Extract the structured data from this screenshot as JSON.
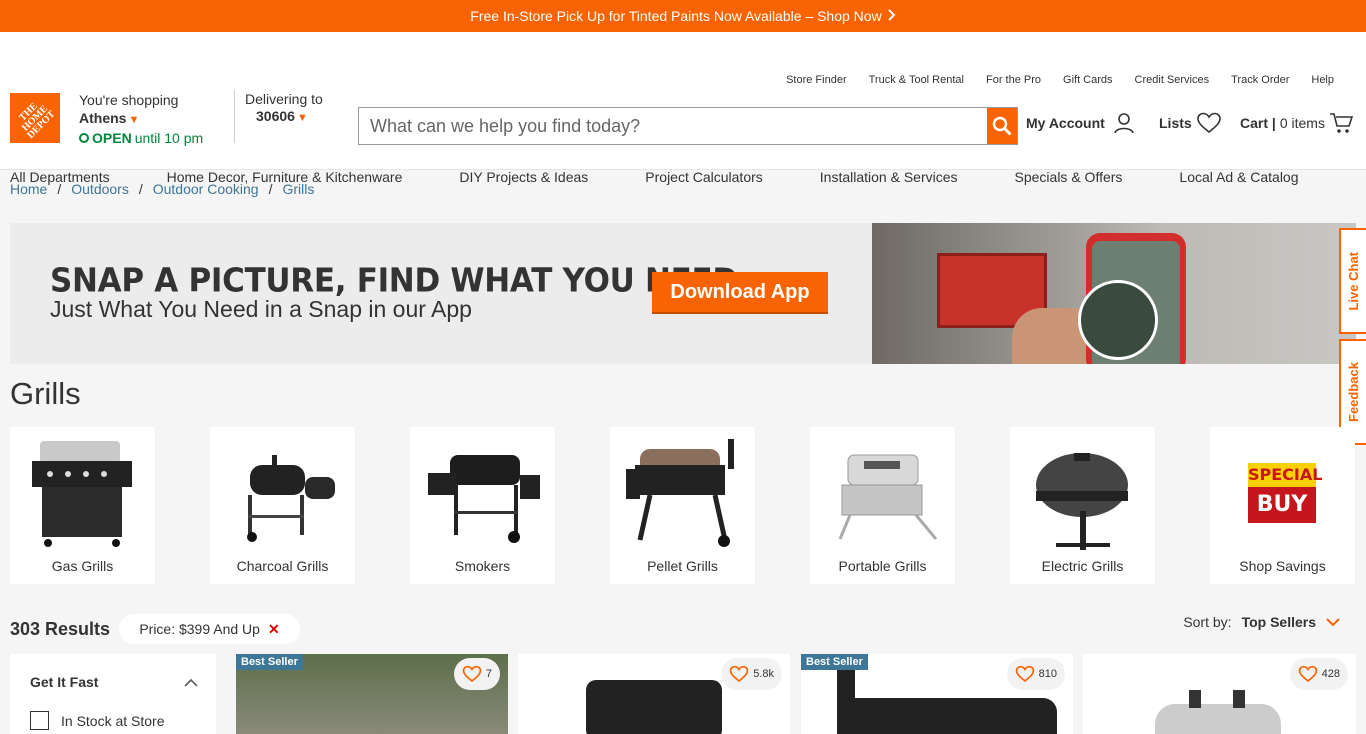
{
  "promo": {
    "text": "Free In-Store Pick Up for Tinted Paints Now Available – Shop Now"
  },
  "logo": {
    "text": "THE HOME DEPOT"
  },
  "store": {
    "label": "You're shopping",
    "city": "Athens",
    "status": "OPEN",
    "hours": "until 10 pm"
  },
  "delivery": {
    "label": "Delivering to",
    "zip": "30606"
  },
  "top_links": [
    "Store Finder",
    "Truck & Tool Rental",
    "For the Pro",
    "Gift Cards",
    "Credit Services",
    "Track Order",
    "Help"
  ],
  "search": {
    "placeholder": "What can we help you find today?"
  },
  "account": {
    "label": "My Account"
  },
  "lists": {
    "label": "Lists"
  },
  "cart": {
    "label": "Cart |",
    "count": "0 items"
  },
  "nav": [
    "All Departments",
    "Home Decor, Furniture & Kitchenware",
    "DIY Projects & Ideas",
    "Project Calculators",
    "Installation & Services",
    "Specials & Offers",
    "Local Ad & Catalog"
  ],
  "breadcrumb": [
    "Home",
    "Outdoors",
    "Outdoor Cooking",
    "Grills"
  ],
  "banner": {
    "headline": "SNAP A PICTURE, FIND WHAT YOU NEED",
    "subhead": "Just What You Need in a Snap in our App",
    "cta": "Download App"
  },
  "side_tabs": {
    "chat": "Live Chat",
    "feedback": "Feedback"
  },
  "page_title": "Grills",
  "categories": [
    {
      "label": "Gas Grills"
    },
    {
      "label": "Charcoal Grills"
    },
    {
      "label": "Smokers"
    },
    {
      "label": "Pellet Grills"
    },
    {
      "label": "Portable Grills"
    },
    {
      "label": "Electric Grills"
    },
    {
      "label": "Shop Savings",
      "badge_top": "SPECIAL",
      "badge_bottom": "BUY"
    }
  ],
  "results": {
    "count": "303 Results",
    "filter_chip": "Price: $399 And Up",
    "sort_label": "Sort by:",
    "sort_value": "Top Sellers"
  },
  "filter_panel": {
    "heading": "Get It Fast",
    "option": "In Stock at Store"
  },
  "products": [
    {
      "badge": "Best Seller",
      "favorites": "7"
    },
    {
      "badge": "",
      "favorites": "5.8k"
    },
    {
      "badge": "Best Seller",
      "favorites": "810"
    },
    {
      "badge": "",
      "favorites": "428"
    }
  ],
  "colors": {
    "brand": "#f96302",
    "link": "#3e7697",
    "open": "#00873c",
    "remove": "#d80000"
  }
}
